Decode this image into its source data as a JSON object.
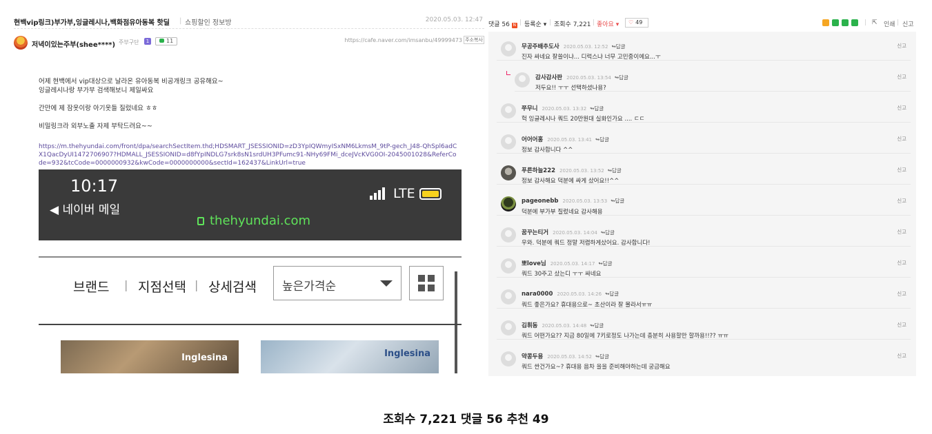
{
  "post": {
    "title": "현백vip링크)부가부,잉글레시나,백화점유아동복 핫딜",
    "separator": "|",
    "board": "쇼핑할인 정보방",
    "date": "2020.05.03. 12:47",
    "author": "저녁이있는주부(shee****)",
    "author_level": "주부구단",
    "author_badge": "1",
    "author_comment_count": "11",
    "url": "https://cafe.naver.com/imsanbu/49999473",
    "url_copy": "주소복사",
    "body_lines": [
      "어제 현백에서 vip대상으로 날라온 유아동복 비공개링크 공유해요~",
      "잉글레시나랑 부가부 검색해보니 제일싸요",
      "",
      "간만에 제 잠옷이랑 아기옷들 질렀네요 ㅎㅎ",
      "",
      "비밀링크라 외부노출 자제 부탁드려요~~"
    ],
    "link": "https://m.thehyundai.com/front/dpa/searchSectItem.thd;HDSMART_JSESSIONID=zD3YpIQWmyISxNM6LkmsM_9tP-gech_J48-QhSpl6adCX1QacDyUI1472706907?HDMALL_JSESSIONID=d8fYpINDLG7srk8sN1srdUH3PFumc91-NHy69FMi_dceJVcKVG0OI-2045001028&ReferCode=932&tcCode=0000000932&kwCode=0000000000&sectId=162437&LinkUrl=true"
  },
  "phone": {
    "time": "10:17",
    "back_label": "◀ 네이버 메일",
    "network": "LTE",
    "domain": "thehyundai.com",
    "nav": [
      "브랜드",
      "지점선택",
      "상세검색"
    ],
    "nav_divider": "|",
    "sort": "높은가격순",
    "brand_logo_1": "Inglesina",
    "brand_logo_2": "Inglesina"
  },
  "comments_header": {
    "count_label": "댓글 56",
    "badge": "N",
    "sort": "등록순",
    "views": "조회수 7,221",
    "like_label": "좋아요",
    "like_count": "49",
    "divider": "|",
    "print": "인쇄",
    "report": "신고"
  },
  "comments": [
    {
      "name": "무공주배추도사",
      "date": "2020.05.03. 12:52",
      "reply": "↬답글",
      "text": "진자 싸네요 잘쓸이냐... 디럭스냐 너무 고민중이에요...ㅜ",
      "report": "신고"
    },
    {
      "name": "감사감사판",
      "date": "2020.05.03. 13:54",
      "reply": "↬답글",
      "text": "저두요!! ㅜㅜ 선택하셨나용?",
      "report": "신고"
    },
    {
      "name": "쭈무니",
      "date": "2020.05.03. 13:32",
      "reply": "↬답글",
      "text": "헉 잉글레시나 쿼드 20만원대 실화인가요 .... ㄷㄷ",
      "report": "신고"
    },
    {
      "name": "어어어홍",
      "date": "2020.05.03. 13:41",
      "reply": "↬답글",
      "text": "정보 감사합니다 ^^",
      "report": "신고"
    },
    {
      "name": "푸른하늘222",
      "date": "2020.05.03. 13:52",
      "reply": "↬답글",
      "text": "정보 감사해요 덕분에 싸게 샀어요!!^^",
      "report": "신고"
    },
    {
      "name": "pageonebb",
      "date": "2020.05.03. 13:53",
      "reply": "↬답글",
      "text": "덕분에 부가부 질렀네요 감사해용",
      "report": "신고"
    },
    {
      "name": "꿈꾸는티거",
      "date": "2020.05.03. 14:04",
      "reply": "↬답글",
      "text": "우와. 덕분에 쿼드 정말 저렴하게샀어요. 감사합니다!",
      "report": "신고"
    },
    {
      "name": "뽀love님",
      "date": "2020.05.03. 14:17",
      "reply": "↬답글",
      "text": "쿼드 30주고 샀는디 ㅜㅜ 싸네요",
      "report": "신고"
    },
    {
      "name": "nara0000",
      "date": "2020.05.03. 14:26",
      "reply": "↬답글",
      "text": "쿼드 좋은가요? 휴대용으로~ 초산이라 잘 몰라서ㅠㅠ",
      "report": "신고"
    },
    {
      "name": "김휘동",
      "date": "2020.05.03. 14:48",
      "reply": "↬답글",
      "text": "쿼드 어떤가요?? 지금 80일에 7키로정도 나가는데 충분히 사용할만 할까용!!?? ㅠㅠ",
      "report": "신고"
    },
    {
      "name": "약콩두용",
      "date": "2020.05.03. 14:52",
      "reply": "↬답글",
      "text": "쿼드 싼건가요~? 휴대용 음차 을을 준비해야하는데 궁금해요",
      "report": "신고"
    }
  ],
  "caption": "조회수 7,221  댓글 56 추천 49",
  "colors": {
    "accent_green": "#2bb24c",
    "like_red": "#e94b4b",
    "link_purple": "#5c4a9c"
  }
}
